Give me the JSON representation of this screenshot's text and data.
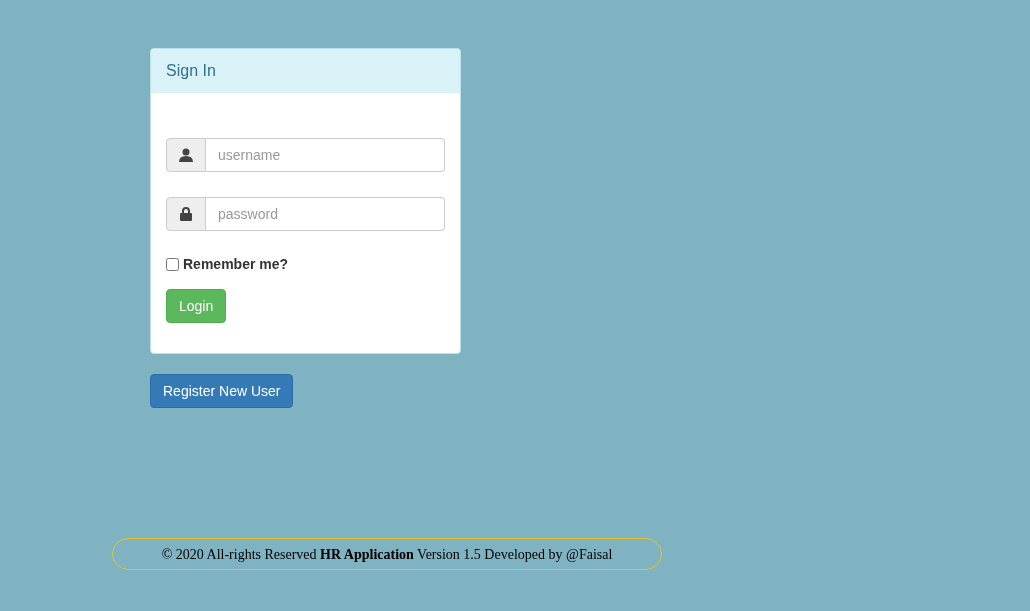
{
  "panel": {
    "title": "Sign In"
  },
  "fields": [
    {
      "kind": "user",
      "placeholder": "username"
    },
    {
      "kind": "lock",
      "placeholder": "password"
    }
  ],
  "remember": {
    "label": "Remember me?",
    "checked": false
  },
  "login_button": "Login",
  "register_button": "Register New User",
  "footer": "© 2020 All-rights Reserved **HR Application** Version 1.5 Developed by @Faisal"
}
